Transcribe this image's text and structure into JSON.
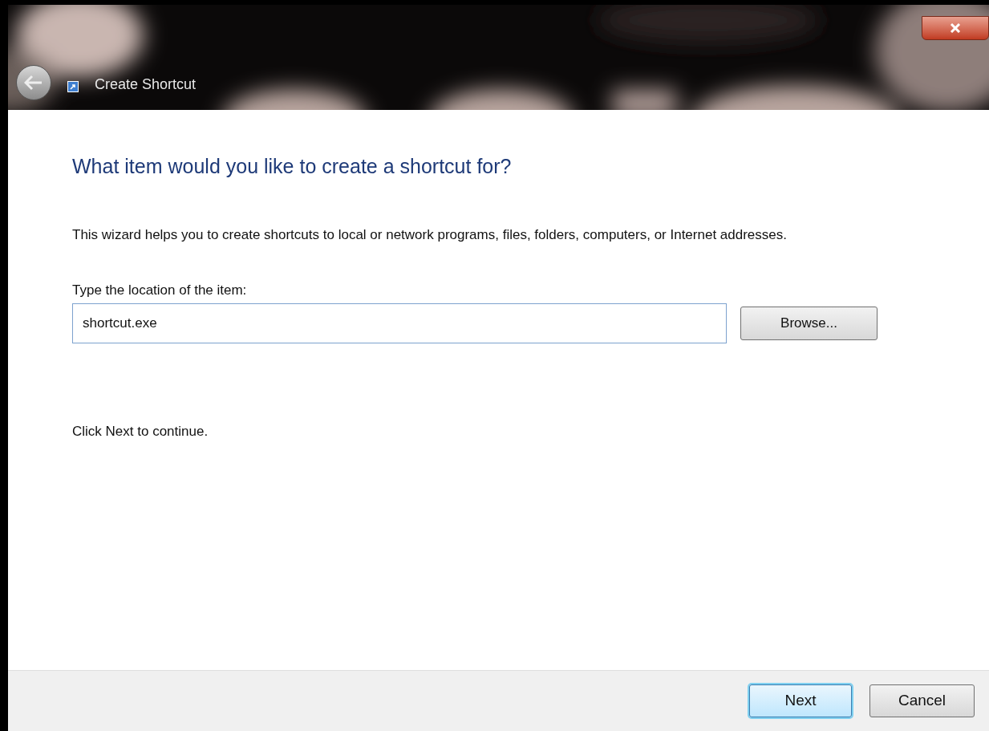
{
  "window": {
    "title": "Create Shortcut"
  },
  "heading": "What item would you like to create a shortcut for?",
  "description": "This wizard helps you to create shortcuts to local or network programs, files, folders, computers, or Internet addresses.",
  "location": {
    "label": "Type the location of the item:",
    "value": "shortcut.exe",
    "browse": "Browse..."
  },
  "hint": "Click Next to continue.",
  "buttons": [
    {
      "label": "Next",
      "default": true
    },
    {
      "label": "Cancel",
      "default": false
    }
  ]
}
